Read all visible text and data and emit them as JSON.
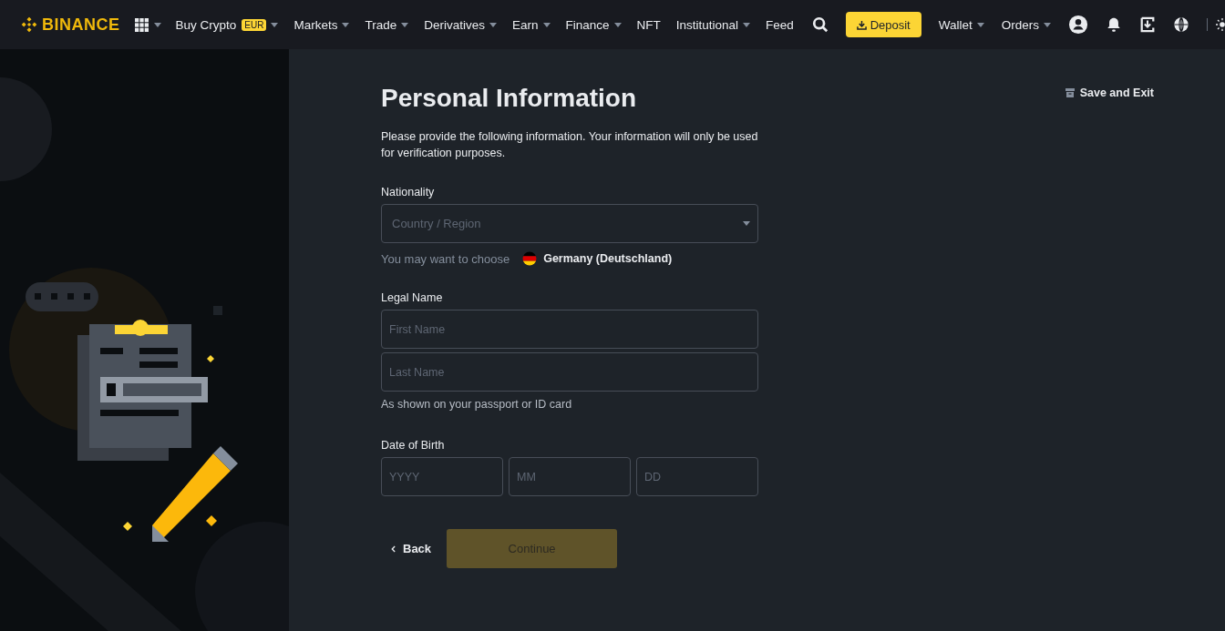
{
  "header": {
    "logo": "BINANCE",
    "nav": [
      {
        "label": "Buy Crypto",
        "badge": "EUR",
        "has_menu": true
      },
      {
        "label": "Markets",
        "has_menu": true
      },
      {
        "label": "Trade",
        "has_menu": true
      },
      {
        "label": "Derivatives",
        "has_menu": true
      },
      {
        "label": "Earn",
        "has_menu": true
      },
      {
        "label": "Finance",
        "has_menu": true
      },
      {
        "label": "NFT",
        "has_menu": false
      },
      {
        "label": "Institutional",
        "has_menu": true
      },
      {
        "label": "Feed",
        "has_menu": false
      }
    ],
    "deposit": "Deposit",
    "account_menus": [
      {
        "label": "Wallet",
        "has_menu": true
      },
      {
        "label": "Orders",
        "has_menu": true
      }
    ]
  },
  "page": {
    "title": "Personal Information",
    "save_exit": "Save and Exit",
    "intro": "Please provide the following information. Your information will only be used for verification purposes.",
    "nationality": {
      "label": "Nationality",
      "placeholder": "Country / Region",
      "suggest_text": "You may want to choose",
      "suggestion": "Germany (Deutschland)"
    },
    "legal_name": {
      "label": "Legal Name",
      "fields": [
        {
          "placeholder": "First Name"
        },
        {
          "placeholder": "Last Name"
        }
      ],
      "hint": "As shown on your passport or ID card"
    },
    "birth": {
      "label": "Date of Birth",
      "fields": [
        {
          "placeholder": "YYYY"
        },
        {
          "placeholder": "MM"
        },
        {
          "placeholder": "DD"
        }
      ]
    },
    "back": "Back",
    "continue": {
      "label": "Continue",
      "disabled": true
    }
  }
}
